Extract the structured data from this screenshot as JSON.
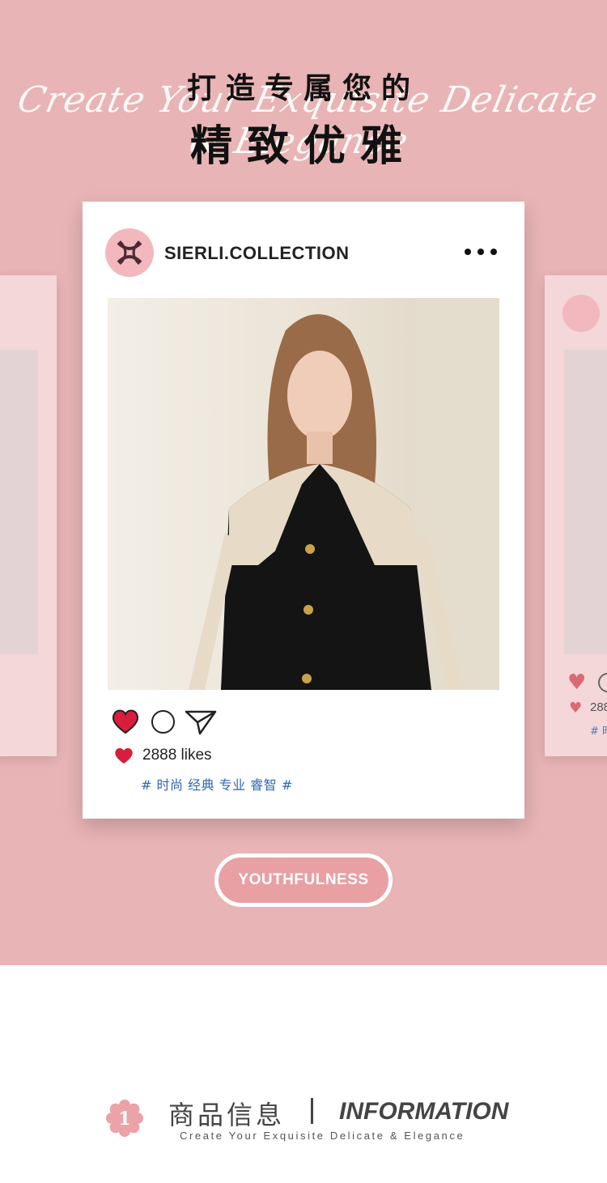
{
  "hero": {
    "script_text": "Create Your Exquisite Delicate & Elegance",
    "title_line1": "打造专属您的",
    "title_line2": "精致优雅",
    "bg_color": "#e8b4b5"
  },
  "post": {
    "account_name": "SIERLI.COLLECTION",
    "logo_icon": "sierli-monogram-icon",
    "more_icon": "more-dots-icon",
    "likes_text": "2888 likes",
    "tags": "# 时尚 经典 专业 睿智 #",
    "actions": [
      "heart-icon",
      "comment-icon",
      "share-icon"
    ]
  },
  "side_card_right": {
    "likes_text": "288",
    "tag": "# 时"
  },
  "badge": {
    "label": "YOUTHFULNESS"
  },
  "section": {
    "number": "1",
    "title_cn": "商品信息",
    "title_en": "INFORMATION",
    "subtitle": "Create Your Exquisite Delicate & Elegance"
  },
  "colors": {
    "accent_pink": "#e8b4b5",
    "heart_red": "#d81e3c",
    "tag_blue": "#2f67b2"
  }
}
